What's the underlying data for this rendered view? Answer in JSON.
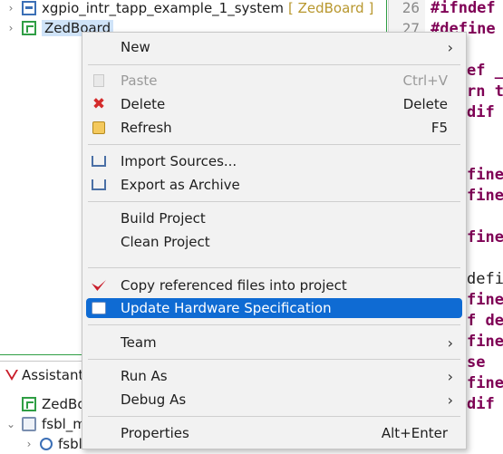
{
  "explorer": {
    "items": [
      {
        "twisty": "›",
        "label": "xgpio_intr_tapp_example_1_system",
        "suffix": "[ ZedBoard ]"
      },
      {
        "twisty": "›",
        "label": "ZedBoard",
        "suffix": ""
      }
    ]
  },
  "assistant": {
    "tab_label": "Assistant",
    "rows": [
      {
        "twisty": "",
        "label": "ZedBo"
      },
      {
        "twisty": "⌄",
        "label": "fsbl_m"
      },
      {
        "twisty": "›",
        "label": "fsbl"
      }
    ]
  },
  "editor": {
    "lines": [
      {
        "ln": "26",
        "code": "#ifndef"
      },
      {
        "ln": "27",
        "code": "#define"
      },
      {
        "ln": "",
        "code": "def _"
      },
      {
        "ln": "",
        "code": "rn t"
      },
      {
        "ln": "",
        "code": "dif"
      },
      {
        "ln": "",
        "code": "fine"
      },
      {
        "ln": "",
        "code": "fine"
      },
      {
        "ln": "",
        "code": "fine"
      },
      {
        "ln": "",
        "code": "defi"
      },
      {
        "ln": "",
        "code": "fine"
      },
      {
        "ln": "",
        "code": "f de"
      },
      {
        "ln": "",
        "code": "fine"
      },
      {
        "ln": "",
        "code": "se"
      },
      {
        "ln": "",
        "code": "fine"
      },
      {
        "ln": "",
        "code": "dif"
      },
      {
        "ln": "",
        "code": "#if"
      }
    ]
  },
  "context_menu": {
    "items": [
      {
        "label": "New",
        "accelerator": "",
        "submenu": true,
        "disabled": false,
        "icon": "none"
      },
      {
        "label": "Paste",
        "accelerator": "Ctrl+V",
        "submenu": false,
        "disabled": true,
        "icon": "paste-icon"
      },
      {
        "label": "Delete",
        "accelerator": "Delete",
        "submenu": false,
        "disabled": false,
        "icon": "delete-icon"
      },
      {
        "label": "Refresh",
        "accelerator": "F5",
        "submenu": false,
        "disabled": false,
        "icon": "refresh-icon"
      },
      {
        "label": "Import Sources...",
        "accelerator": "",
        "submenu": false,
        "disabled": false,
        "icon": "import-icon"
      },
      {
        "label": "Export as Archive",
        "accelerator": "",
        "submenu": false,
        "disabled": false,
        "icon": "export-icon"
      },
      {
        "label": "Build Project",
        "accelerator": "",
        "submenu": false,
        "disabled": false,
        "icon": "none"
      },
      {
        "label": "Clean Project",
        "accelerator": "",
        "submenu": false,
        "disabled": false,
        "icon": "none"
      },
      {
        "label": "Copy referenced files into project",
        "accelerator": "",
        "submenu": false,
        "disabled": false,
        "icon": "copy-referenced-icon"
      },
      {
        "label": "Update Hardware Specification",
        "accelerator": "",
        "submenu": false,
        "disabled": false,
        "selected": true,
        "icon": "update-hardware-icon"
      },
      {
        "label": "Team",
        "accelerator": "",
        "submenu": true,
        "disabled": false,
        "icon": "none"
      },
      {
        "label": "Run As",
        "accelerator": "",
        "submenu": true,
        "disabled": false,
        "icon": "none"
      },
      {
        "label": "Debug As",
        "accelerator": "",
        "submenu": true,
        "disabled": false,
        "icon": "none"
      },
      {
        "label": "Properties",
        "accelerator": "Alt+Enter",
        "submenu": false,
        "disabled": false,
        "icon": "none"
      }
    ]
  },
  "colors": {
    "selection": "#0f6bd3",
    "tree_selection": "#cfe3f8",
    "suffix": "#b8972e",
    "keyword": "#7f0055",
    "delete_icon": "#d42b2b"
  }
}
